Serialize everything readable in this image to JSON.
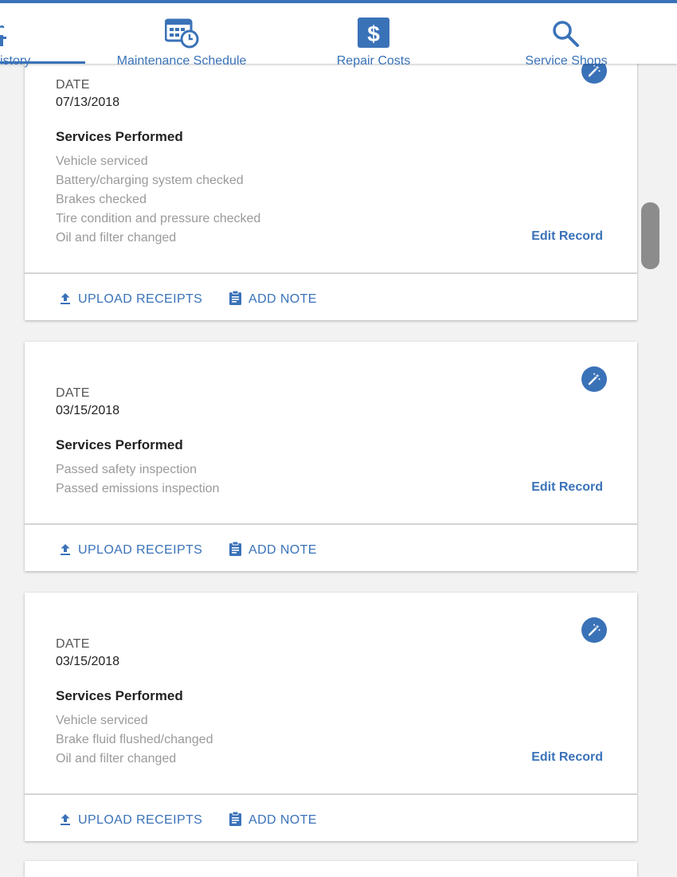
{
  "tabs": [
    {
      "label": "istory"
    },
    {
      "label": "Maintenance Schedule"
    },
    {
      "label": "Repair Costs"
    },
    {
      "label": "Service Shops"
    }
  ],
  "colors": {
    "accent": "#3a72b8",
    "muted": "#9a9a9a"
  },
  "records": [
    {
      "date_label": "DATE",
      "date": "07/13/2018",
      "services_title": "Services Performed",
      "services": [
        "Vehicle serviced",
        "Battery/charging system checked",
        "Brakes checked",
        "Tire condition and pressure checked",
        "Oil and filter changed"
      ],
      "edit_label": "Edit Record",
      "upload_label": "UPLOAD RECEIPTS",
      "note_label": "ADD NOTE"
    },
    {
      "date_label": "DATE",
      "date": "03/15/2018",
      "services_title": "Services Performed",
      "services": [
        "Passed safety inspection",
        "Passed emissions inspection"
      ],
      "edit_label": "Edit Record",
      "upload_label": "UPLOAD RECEIPTS",
      "note_label": "ADD NOTE"
    },
    {
      "date_label": "DATE",
      "date": "03/15/2018",
      "services_title": "Services Performed",
      "services": [
        "Vehicle serviced",
        "Brake fluid flushed/changed",
        "Oil and filter changed"
      ],
      "edit_label": "Edit Record",
      "upload_label": "UPLOAD RECEIPTS",
      "note_label": "ADD NOTE"
    }
  ]
}
